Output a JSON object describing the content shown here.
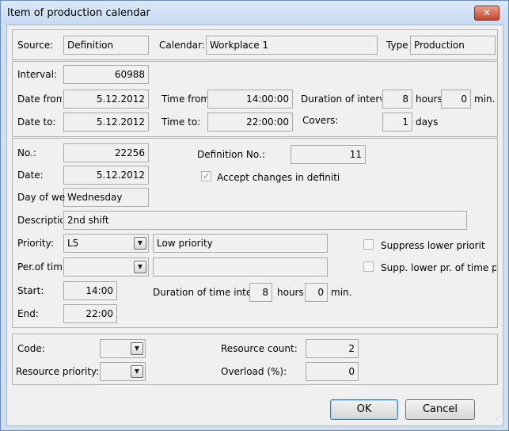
{
  "window": {
    "title": "Item of production calendar",
    "close_glyph": "✕"
  },
  "header": {
    "source_label": "Source:",
    "source_value": "Definition",
    "calendar_label": "Calendar:",
    "calendar_value": "Workplace 1",
    "type_label": "Type",
    "type_value": "Production"
  },
  "interval": {
    "interval_label": "Interval:",
    "interval_value": "60988",
    "date_from_label": "Date from",
    "date_from_value": "5.12.2012",
    "time_from_label": "Time from",
    "time_from_value": "14:00:00",
    "duration_label": "Duration of interv",
    "duration_hours": "8",
    "hours_label": "hours",
    "duration_min": "0",
    "min_label": "min.",
    "date_to_label": "Date to:",
    "date_to_value": "5.12.2012",
    "time_to_label": "Time to:",
    "time_to_value": "22:00:00",
    "covers_label": "Covers:",
    "covers_value": "1",
    "days_label": "days"
  },
  "detail": {
    "no_label": "No.:",
    "no_value": "22256",
    "defno_label": "Definition No.:",
    "defno_value": "11",
    "date_label": "Date:",
    "date_value": "5.12.2012",
    "accept_label": "Accept  changes in definiti",
    "accept_checked": true,
    "check_glyph": "✓",
    "dow_label": "Day of week",
    "dow_value": "Wednesday",
    "desc_label": "Descriptio",
    "desc_value": "2nd shift",
    "priority_label": "Priority:",
    "priority_value": "L5",
    "priority_text": "Low priority",
    "suppress_label": "Suppress lower priorit",
    "suppress_checked": false,
    "pertime_label": "Per.of tim",
    "pertime_value": "",
    "pertime_text": "",
    "supp_time_label": "Supp. lower pr. of time p",
    "supp_time_checked": false,
    "start_label": "Start:",
    "start_value": "14:00",
    "dur_label": "Duration of time inter",
    "dur_hours": "8",
    "hours_label": "hours",
    "dur_min": "0",
    "min_label": "min.",
    "end_label": "End:",
    "end_value": "22:00"
  },
  "resources": {
    "code_label": "Code:",
    "code_value": "",
    "count_label": "Resource count:",
    "count_value": "2",
    "rprio_label": "Resource priority:",
    "rprio_value": "",
    "overload_label": "Overload (%):",
    "overload_value": "0"
  },
  "buttons": {
    "ok": "OK",
    "cancel": "Cancel"
  },
  "icons": {
    "dropdown": "▼",
    "grip": "⋰"
  },
  "colors": {
    "title_bg": "#c7dbf2",
    "close_bg": "#c7432c",
    "field_bg": "#f0f0f0"
  }
}
